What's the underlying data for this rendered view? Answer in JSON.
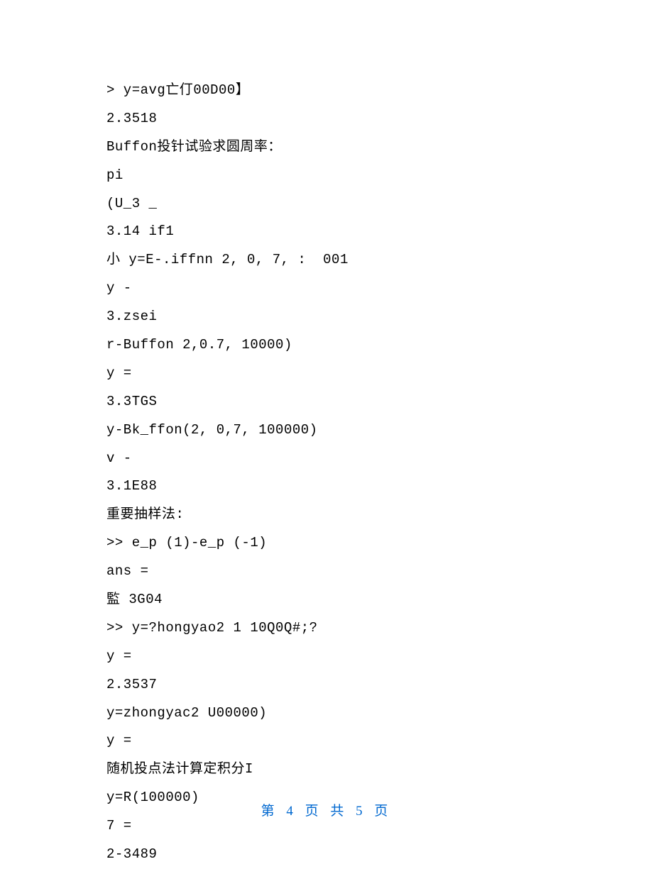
{
  "lines": [
    "> y=avg亡仃00D00】",
    "2.3518",
    "Buffon投针试验求圆周率：",
    "pi",
    "(U_3 _",
    "3.14 if1",
    "小 y=E-.iffnn 2, 0, 7, :  001",
    "y -",
    "3.zsei",
    "r-Buffon 2,0.7, 10000)",
    "y =",
    "3.3TGS",
    "y-Bk_ffon(2, 0,7, 100000)",
    "v -",
    "3.1E88",
    "重要抽样法:",
    ">> e_p (1)-e_p (-1)",
    "ans =",
    "監 3G04",
    ">> y=?hongyao2 1 10Q0Q#;?",
    "y =",
    "2.3537",
    "y=zhongyac2 U00000)",
    "y =",
    "随机投点法计算定积分I",
    "y=R(100000)",
    "7 =",
    "2-3489"
  ],
  "footer": "第 4 页 共 5 页"
}
